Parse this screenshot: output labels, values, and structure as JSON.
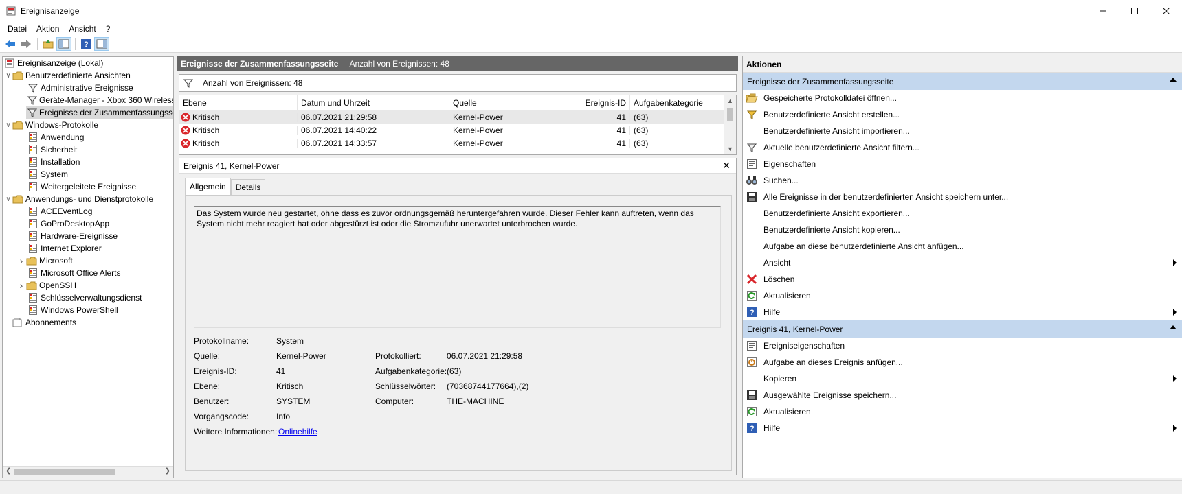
{
  "window": {
    "title": "Ereignisanzeige"
  },
  "menu": [
    "Datei",
    "Aktion",
    "Ansicht",
    "?"
  ],
  "tree": [
    {
      "label": "Ereignisanzeige (Lokal)",
      "level": 0,
      "expander": "",
      "icon": "event-viewer-icon"
    },
    {
      "label": "Benutzerdefinierte Ansichten",
      "level": 0,
      "expander": "open",
      "icon": "folder-icon"
    },
    {
      "label": "Administrative Ereignisse",
      "level": 2,
      "expander": "",
      "icon": "filter-icon"
    },
    {
      "label": "Geräte-Manager - Xbox 360 Wireless",
      "level": 2,
      "expander": "",
      "icon": "filter-icon"
    },
    {
      "label": "Ereignisse der Zusammenfassungsseite",
      "level": 2,
      "expander": "",
      "icon": "filter-icon",
      "selected": true
    },
    {
      "label": "Windows-Protokolle",
      "level": 0,
      "expander": "open",
      "icon": "folder-icon"
    },
    {
      "label": "Anwendung",
      "level": 2,
      "expander": "",
      "icon": "log-icon"
    },
    {
      "label": "Sicherheit",
      "level": 2,
      "expander": "",
      "icon": "log-icon"
    },
    {
      "label": "Installation",
      "level": 2,
      "expander": "",
      "icon": "log-icon"
    },
    {
      "label": "System",
      "level": 2,
      "expander": "",
      "icon": "log-icon"
    },
    {
      "label": "Weitergeleitete Ereignisse",
      "level": 2,
      "expander": "",
      "icon": "log-icon"
    },
    {
      "label": "Anwendungs- und Dienstprotokolle",
      "level": 0,
      "expander": "open",
      "icon": "folder-icon"
    },
    {
      "label": "ACEEventLog",
      "level": 2,
      "expander": "",
      "icon": "log-icon"
    },
    {
      "label": "GoProDesktopApp",
      "level": 2,
      "expander": "",
      "icon": "log-icon"
    },
    {
      "label": "Hardware-Ereignisse",
      "level": 2,
      "expander": "",
      "icon": "log-icon"
    },
    {
      "label": "Internet Explorer",
      "level": 2,
      "expander": "",
      "icon": "log-icon"
    },
    {
      "label": "Microsoft",
      "level": 1,
      "expander": "closed",
      "icon": "folder-icon"
    },
    {
      "label": "Microsoft Office Alerts",
      "level": 2,
      "expander": "",
      "icon": "log-icon"
    },
    {
      "label": "OpenSSH",
      "level": 1,
      "expander": "closed",
      "icon": "folder-icon"
    },
    {
      "label": "Schlüsselverwaltungsdienst",
      "level": 2,
      "expander": "",
      "icon": "log-icon"
    },
    {
      "label": "Windows PowerShell",
      "level": 2,
      "expander": "",
      "icon": "log-icon"
    },
    {
      "label": "Abonnements",
      "level": 0,
      "expander": "",
      "icon": "subscription-icon"
    }
  ],
  "middle": {
    "header_title": "Ereignisse der Zusammenfassungsseite",
    "header_count": "Anzahl von Ereignissen: 48",
    "filter_text": "Anzahl von Ereignissen: 48",
    "columns": [
      "Ebene",
      "Datum und Uhrzeit",
      "Quelle",
      "Ereignis-ID",
      "Aufgabenkategorie"
    ],
    "rows": [
      [
        "Kritisch",
        "06.07.2021 21:29:58",
        "Kernel-Power",
        "41",
        "(63)"
      ],
      [
        "Kritisch",
        "06.07.2021 14:40:22",
        "Kernel-Power",
        "41",
        "(63)"
      ],
      [
        "Kritisch",
        "06.07.2021 14:33:57",
        "Kernel-Power",
        "41",
        "(63)"
      ]
    ]
  },
  "detail": {
    "title": "Ereignis 41, Kernel-Power",
    "tabs": [
      "Allgemein",
      "Details"
    ],
    "description": "Das System wurde neu gestartet, ohne dass es zuvor ordnungsgemäß heruntergefahren wurde. Dieser Fehler kann auftreten, wenn das System nicht mehr reagiert hat oder abgestürzt ist oder die Stromzufuhr unerwartet unterbrochen wurde.",
    "props": {
      "protokollname_label": "Protokollname:",
      "protokollname": "System",
      "quelle_label": "Quelle:",
      "quelle": "Kernel-Power",
      "protokolliert_label": "Protokolliert:",
      "protokolliert": "06.07.2021 21:29:58",
      "ereignisid_label": "Ereignis-ID:",
      "ereignisid": "41",
      "aufgabenkategorie_label": "Aufgabenkategorie:",
      "aufgabenkategorie": "(63)",
      "ebene_label": "Ebene:",
      "ebene": "Kritisch",
      "schluesselwoerter_label": "Schlüsselwörter:",
      "schluesselwoerter": "(70368744177664),(2)",
      "benutzer_label": "Benutzer:",
      "benutzer": "SYSTEM",
      "computer_label": "Computer:",
      "computer": "THE-MACHINE",
      "vorgangscode_label": "Vorgangscode:",
      "vorgangscode": "Info",
      "weitere_label": "Weitere Informationen:",
      "weitere_link": "Onlinehilfe"
    }
  },
  "actions": {
    "header": "Aktionen",
    "section1": "Ereignisse der Zusammenfassungsseite",
    "items1": [
      {
        "label": "Gespeicherte Protokolldatei öffnen...",
        "icon": "open-folder-icon",
        "sub": false
      },
      {
        "label": "Benutzerdefinierte Ansicht erstellen...",
        "icon": "filter-create-icon",
        "sub": false
      },
      {
        "label": "Benutzerdefinierte Ansicht importieren...",
        "icon": "",
        "sub": false
      },
      {
        "label": "Aktuelle benutzerdefinierte Ansicht filtern...",
        "icon": "filter-icon",
        "sub": false
      },
      {
        "label": "Eigenschaften",
        "icon": "properties-icon",
        "sub": false
      },
      {
        "label": "Suchen...",
        "icon": "binoculars-icon",
        "sub": false
      },
      {
        "label": "Alle Ereignisse in der benutzerdefinierten Ansicht speichern unter...",
        "icon": "save-icon",
        "sub": false
      },
      {
        "label": "Benutzerdefinierte Ansicht exportieren...",
        "icon": "",
        "sub": false
      },
      {
        "label": "Benutzerdefinierte Ansicht kopieren...",
        "icon": "",
        "sub": false
      },
      {
        "label": "Aufgabe an diese benutzerdefinierte Ansicht anfügen...",
        "icon": "",
        "sub": false
      },
      {
        "label": "Ansicht",
        "icon": "",
        "sub": true
      },
      {
        "label": "Löschen",
        "icon": "delete-icon",
        "sub": false
      },
      {
        "label": "Aktualisieren",
        "icon": "refresh-icon",
        "sub": false
      },
      {
        "label": "Hilfe",
        "icon": "help-icon",
        "sub": true
      }
    ],
    "section2": "Ereignis 41, Kernel-Power",
    "items2": [
      {
        "label": "Ereigniseigenschaften",
        "icon": "properties-icon",
        "sub": false
      },
      {
        "label": "Aufgabe an dieses Ereignis anfügen...",
        "icon": "task-icon",
        "sub": false
      },
      {
        "label": "Kopieren",
        "icon": "",
        "sub": true
      },
      {
        "label": "Ausgewählte Ereignisse speichern...",
        "icon": "save-icon",
        "sub": false
      },
      {
        "label": "Aktualisieren",
        "icon": "refresh-icon",
        "sub": false
      },
      {
        "label": "Hilfe",
        "icon": "help-icon",
        "sub": true
      }
    ]
  },
  "colors": {
    "accent_section": "#c3d7ee",
    "header_dark": "#666666",
    "critical": "#d9262b"
  }
}
